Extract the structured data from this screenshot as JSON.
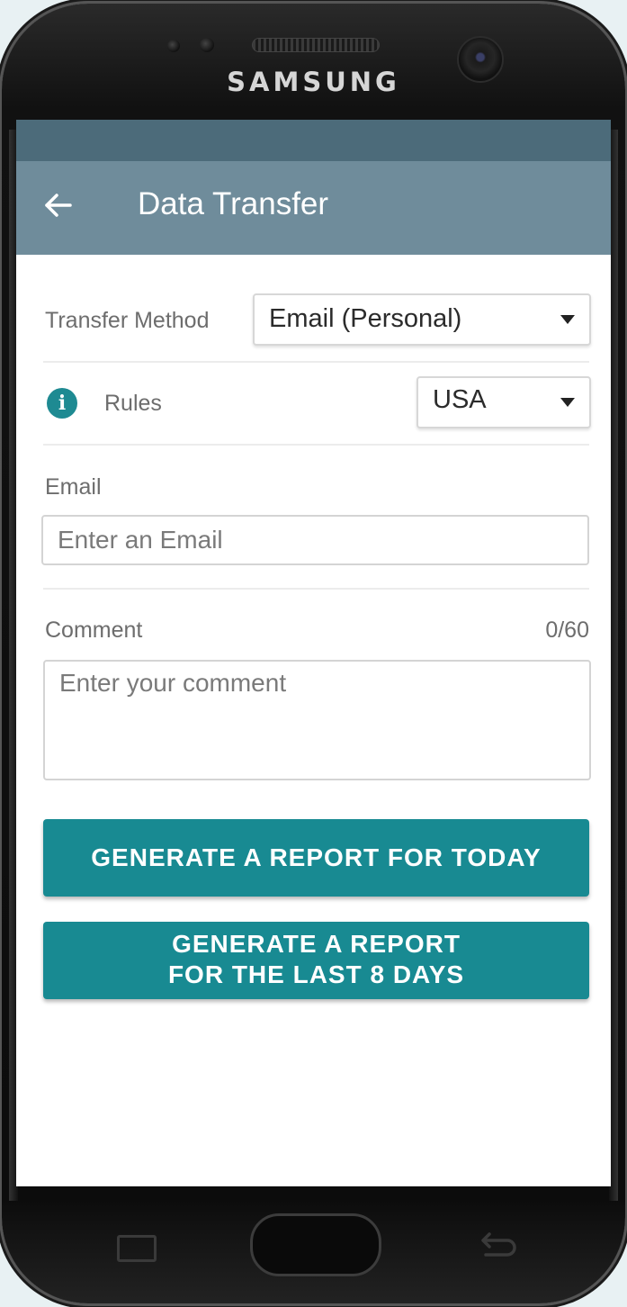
{
  "device": {
    "brand": "SAMSUNG"
  },
  "app_bar": {
    "back_icon": "arrow-left-icon",
    "title": "Data Transfer",
    "color": "#6f8c9b"
  },
  "form": {
    "transfer_method": {
      "label": "Transfer Method",
      "value": "Email (Personal)"
    },
    "rules": {
      "icon": "info-icon",
      "label": "Rules",
      "value": "USA"
    },
    "email": {
      "label": "Email",
      "placeholder": "Enter an Email",
      "value": ""
    },
    "comment": {
      "label": "Comment",
      "counter": "0/60",
      "placeholder": "Enter your comment",
      "value": ""
    }
  },
  "buttons": {
    "today": "GENERATE A REPORT FOR TODAY",
    "last8_line1": "GENERATE A REPORT",
    "last8_line2": "FOR THE LAST 8 DAYS",
    "color": "#188a92"
  },
  "navbar": {
    "recent_icon": "recent-apps-icon",
    "home_icon": "home-button",
    "back_icon": "back-icon"
  }
}
